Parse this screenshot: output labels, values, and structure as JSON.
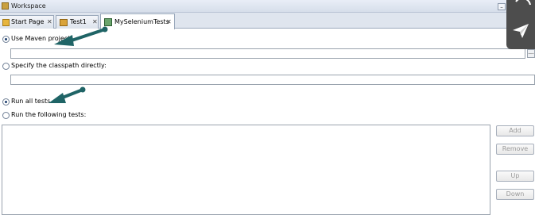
{
  "window": {
    "title": "Workspace"
  },
  "tabs": [
    {
      "label": "Start Page",
      "close": "✕"
    },
    {
      "label": "Test1",
      "close": "✕"
    },
    {
      "label": "MySeleniumTests",
      "close": "✕"
    }
  ],
  "classpath": {
    "use_maven_label": "Use Maven project:",
    "use_maven_selected": true,
    "maven_value": "",
    "browse_label": "...",
    "specify_label": "Specify the classpath directly:",
    "specify_selected": false,
    "classpath_value": ""
  },
  "tests": {
    "run_all_label": "Run all tests",
    "run_all_selected": true,
    "run_following_label": "Run the following tests:",
    "run_following_selected": false
  },
  "buttons": {
    "add": "Add",
    "remove": "Remove",
    "up": "Up",
    "down": "Down"
  },
  "colors": {
    "arrow": "#1f6466",
    "overlay": "#4d4d4d"
  }
}
